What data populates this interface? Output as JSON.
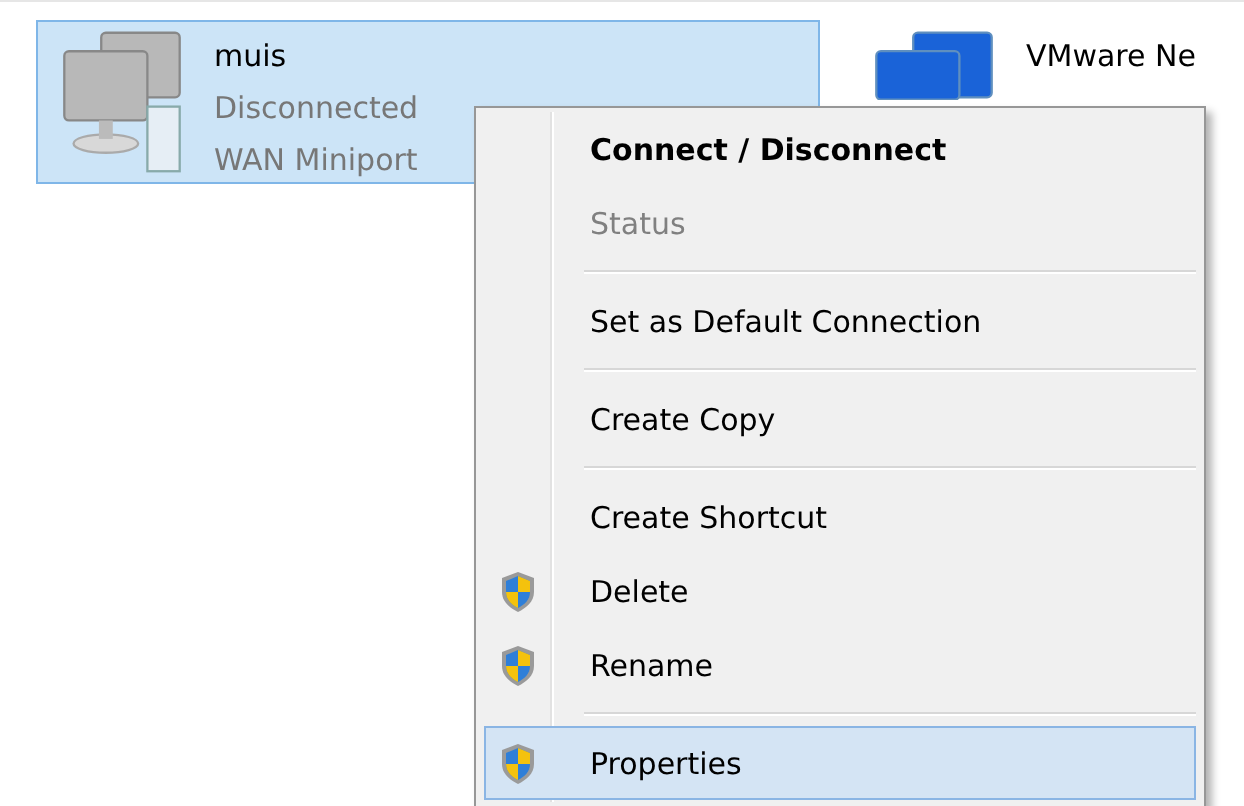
{
  "connections": [
    {
      "name": "muis",
      "status": "Disconnected",
      "device": "WAN Miniport",
      "selected": true
    },
    {
      "name": "VMware Ne",
      "selected": false
    }
  ],
  "context_menu": {
    "items": [
      {
        "kind": "item",
        "label": "Connect / Disconnect",
        "default": true,
        "disabled": false,
        "shield": false,
        "selected": false
      },
      {
        "kind": "item",
        "label": "Status",
        "default": false,
        "disabled": true,
        "shield": false,
        "selected": false
      },
      {
        "kind": "separator"
      },
      {
        "kind": "item",
        "label": "Set as Default Connection",
        "default": false,
        "disabled": false,
        "shield": false,
        "selected": false
      },
      {
        "kind": "separator"
      },
      {
        "kind": "item",
        "label": "Create Copy",
        "default": false,
        "disabled": false,
        "shield": false,
        "selected": false
      },
      {
        "kind": "separator"
      },
      {
        "kind": "item",
        "label": "Create Shortcut",
        "default": false,
        "disabled": false,
        "shield": false,
        "selected": false
      },
      {
        "kind": "item",
        "label": "Delete",
        "default": false,
        "disabled": false,
        "shield": true,
        "selected": false
      },
      {
        "kind": "item",
        "label": "Rename",
        "default": false,
        "disabled": false,
        "shield": true,
        "selected": false
      },
      {
        "kind": "separator"
      },
      {
        "kind": "item",
        "label": "Properties",
        "default": false,
        "disabled": false,
        "shield": true,
        "selected": true
      }
    ]
  }
}
